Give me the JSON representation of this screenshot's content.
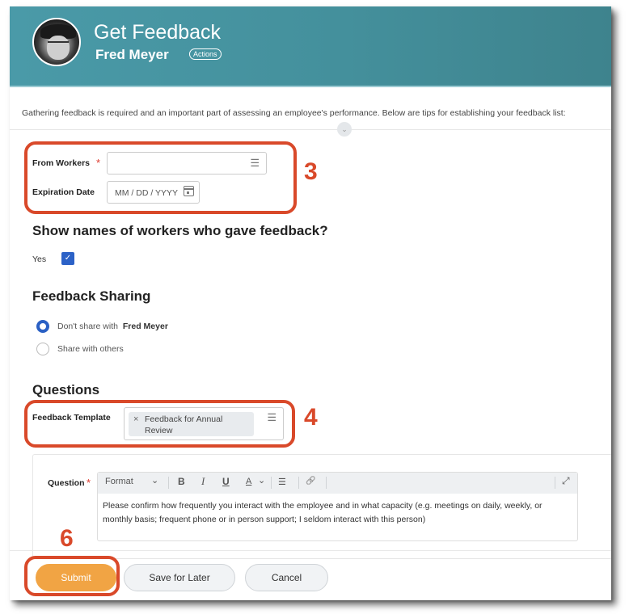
{
  "header": {
    "title": "Get Feedback",
    "subject_name": "Fred Meyer",
    "actions_label": "Actions",
    "colors": {
      "header_start": "#4a9aa8",
      "header_end": "#3e838d"
    }
  },
  "intro_text": "Gathering feedback is required and an important part of assessing an employee's performance. Below are tips for establishing your feedback list:",
  "form": {
    "from_workers": {
      "label": "From Workers",
      "required": true,
      "value": "",
      "icon": "list-icon"
    },
    "expiration_date": {
      "label": "Expiration Date",
      "placeholder": "MM / DD / YYYY",
      "icon": "calendar-icon"
    }
  },
  "show_names": {
    "heading": "Show names of workers who gave feedback?",
    "option_label": "Yes",
    "checked": true,
    "check_glyph": "✓"
  },
  "sharing": {
    "heading": "Feedback Sharing",
    "options": [
      {
        "label": "Don't share with",
        "emphasis": "Fred Meyer",
        "selected": true
      },
      {
        "label": "Share with others",
        "emphasis": "",
        "selected": false
      }
    ]
  },
  "questions": {
    "heading": "Questions",
    "template_label": "Feedback Template",
    "template_value": "Feedback for Annual Review",
    "remove_glyph": "×",
    "question_label": "Question",
    "question_required": true,
    "toolbar": {
      "format": "Format",
      "bold": "B",
      "italic": "I",
      "underline": "U",
      "font_color": "A",
      "chevron": "⌄",
      "list": "☰",
      "link": "🔗",
      "expand": "⤢"
    },
    "question_text": "Please confirm how frequently you interact with the employee and in what capacity (e.g. meetings on daily, weekly, or monthly basis; frequent phone or in person support; I seldom interact with this person)"
  },
  "buttons": {
    "submit": "Submit",
    "save_for_later": "Save for Later",
    "cancel": "Cancel"
  },
  "annotations": {
    "step_3": "3",
    "step_4": "4",
    "step_6": "6",
    "color": "#d9492a"
  },
  "glyphs": {
    "required": "*",
    "list": "☰",
    "collapse": "⌄"
  }
}
